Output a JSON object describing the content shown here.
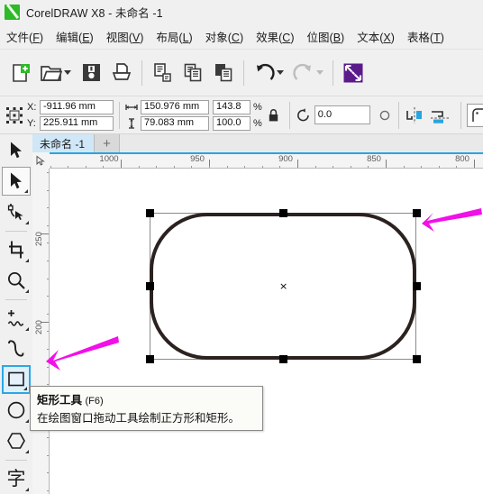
{
  "window": {
    "app_name": "CorelDRAW X8",
    "title": "CorelDRAW X8 - 未命名 -1",
    "logo_icon": "coreldraw-logo-icon"
  },
  "menubar": {
    "items": [
      {
        "name": "file",
        "label": "文件",
        "mnemonic": "F"
      },
      {
        "name": "edit",
        "label": "编辑",
        "mnemonic": "E"
      },
      {
        "name": "view",
        "label": "视图",
        "mnemonic": "V"
      },
      {
        "name": "layout",
        "label": "布局",
        "mnemonic": "L"
      },
      {
        "name": "object",
        "label": "对象",
        "mnemonic": "C"
      },
      {
        "name": "effects",
        "label": "效果",
        "mnemonic": "C"
      },
      {
        "name": "bitmap",
        "label": "位图",
        "mnemonic": "B"
      },
      {
        "name": "text",
        "label": "文本",
        "mnemonic": "X"
      },
      {
        "name": "table",
        "label": "表格",
        "mnemonic": "T"
      }
    ]
  },
  "toolbar": {
    "buttons": [
      {
        "name": "new-document-button",
        "icon": "new-document-icon",
        "has_caret": false,
        "enabled": true
      },
      {
        "name": "open-document-button",
        "icon": "open-folder-icon",
        "has_caret": true,
        "enabled": true
      },
      {
        "name": "save-document-button",
        "icon": "save-floppy-icon",
        "has_caret": false,
        "enabled": true
      },
      {
        "name": "print-button",
        "icon": "printer-icon",
        "has_caret": false,
        "enabled": true
      },
      {
        "name": "cut-button",
        "icon": "cut-clipboard-icon",
        "has_caret": false,
        "enabled": true
      },
      {
        "name": "copy-button",
        "icon": "copy-icon",
        "has_caret": false,
        "enabled": true
      },
      {
        "name": "paste-button",
        "icon": "paste-icon",
        "has_caret": false,
        "enabled": true
      },
      {
        "name": "undo-button",
        "icon": "undo-arrow-icon",
        "has_caret": true,
        "enabled": true
      },
      {
        "name": "redo-button",
        "icon": "redo-arrow-icon",
        "has_caret": true,
        "enabled": false
      },
      {
        "name": "import-button",
        "icon": "import-arrows-icon",
        "has_caret": false,
        "enabled": true
      }
    ]
  },
  "property_bar": {
    "object_origin_icon": "object-position-grid-icon",
    "position": {
      "x_label": "X:",
      "x_value": "-911.96 mm",
      "y_label": "Y:",
      "y_value": "225.911 mm"
    },
    "size": {
      "width_icon": "width-arrows-icon",
      "width_value": "150.976 mm",
      "height_icon": "height-arrows-icon",
      "height_value": "79.083 mm"
    },
    "scale": {
      "horizontal_value": "143.8",
      "horizontal_unit": "%",
      "vertical_value": "100.0",
      "vertical_unit": "%"
    },
    "lock_ratio_icon": "lock-closed-icon",
    "rotation": {
      "icon": "rotate-angle-icon",
      "value": "0.0",
      "anchor_icon": "rotation-center-circle-icon"
    },
    "mirror_horizontal_icon": "mirror-horizontal-icon",
    "mirror_vertical_icon": "mirror-vertical-icon",
    "corner_radius_icon": "corner-round-icon"
  },
  "document_tabs": {
    "tabs": [
      {
        "name": "tab-untitled-1",
        "label": "未命名 -1",
        "active": true
      }
    ],
    "add_label": "+"
  },
  "rulers": {
    "unit": "mm",
    "horizontal_labels": [
      "1000",
      "950",
      "900",
      "850",
      "800"
    ],
    "vertical_labels": [
      "250",
      "200"
    ],
    "origin_icon": "ruler-origin-icon"
  },
  "toolbox": {
    "tools": [
      {
        "name": "tool-pick",
        "icon": "pick-arrow-icon",
        "active": false,
        "flyout": true,
        "group": 0
      },
      {
        "name": "tool-shape",
        "icon": "shape-node-icon",
        "active": false,
        "flyout": true,
        "group": 0
      },
      {
        "name": "tool-crop",
        "icon": "crop-icon",
        "active": false,
        "flyout": true,
        "group": 1
      },
      {
        "name": "tool-zoom",
        "icon": "magnifier-icon",
        "active": false,
        "flyout": true,
        "group": 1
      },
      {
        "name": "tool-freehand",
        "icon": "freehand-curve-icon",
        "active": false,
        "flyout": true,
        "group": 2
      },
      {
        "name": "tool-artistic-media",
        "icon": "artistic-media-icon",
        "active": false,
        "flyout": false,
        "group": 2
      },
      {
        "name": "tool-rectangle",
        "icon": "rectangle-icon",
        "active": true,
        "flyout": true,
        "group": 2
      },
      {
        "name": "tool-ellipse",
        "icon": "ellipse-icon",
        "active": false,
        "flyout": true,
        "group": 2
      },
      {
        "name": "tool-polygon",
        "icon": "polygon-icon",
        "active": false,
        "flyout": true,
        "group": 2
      },
      {
        "name": "tool-text",
        "icon": "text-glyph-icon",
        "active": false,
        "flyout": true,
        "group": 3
      }
    ]
  },
  "canvas": {
    "shape": {
      "name": "rounded-rectangle",
      "stroke_color": "#2b2220",
      "fill_color": "#ffffff"
    },
    "selection": {
      "handle_color": "#000000",
      "handle_count": 8,
      "center_marker": "×"
    },
    "annotations": [
      {
        "name": "annotation-arrow-shape",
        "color": "#f210e8",
        "points_to": "rounded-rectangle-corner"
      },
      {
        "name": "annotation-arrow-toolbox",
        "color": "#f210e8",
        "points_to": "tool-rectangle"
      }
    ]
  },
  "tooltip": {
    "title": "矩形工具",
    "shortcut": "(F6)",
    "body": "在绘图窗口拖动工具绘制正方形和矩形。"
  }
}
